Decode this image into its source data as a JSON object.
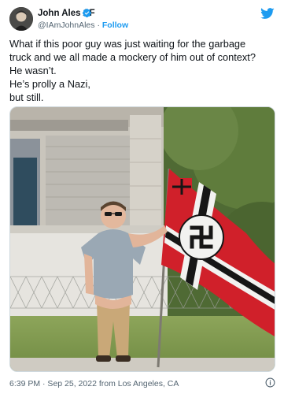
{
  "author": {
    "display_name": "John Ales AF",
    "handle": "@IAmJohnAles",
    "separator": "·",
    "follow_label": "Follow"
  },
  "icons": {
    "verified": "verified-badge-icon",
    "brand": "twitter-bird-icon",
    "info": "info-icon",
    "avatar": "avatar"
  },
  "colors": {
    "accent": "#1d9bf0",
    "text": "#0f1419",
    "muted": "#536471",
    "flag_red": "#d0202a"
  },
  "tweet": {
    "lines": [
      "What if this poor guy was just waiting for the garbage",
      "truck and we all made a mockery of him out of context?",
      "He wasn’t.",
      "He’s prolly a Nazi,",
      "but still."
    ]
  },
  "meta": {
    "timestamp": "6:39 PM · Sep 25, 2022 from Los Angeles, CA"
  }
}
